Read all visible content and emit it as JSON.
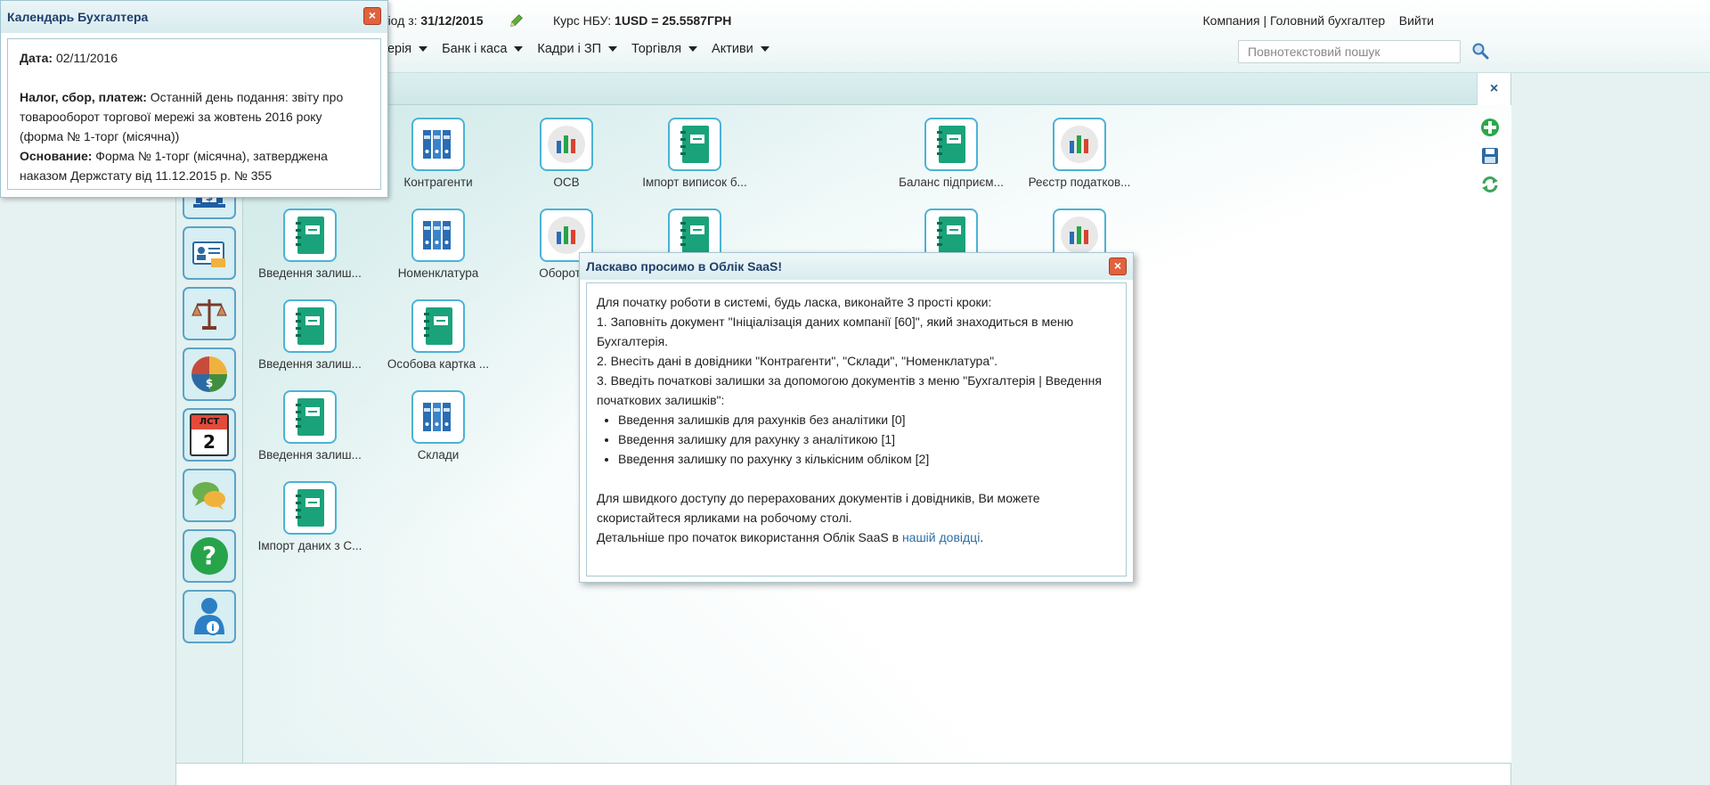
{
  "header": {
    "period_prefix": "еріод з:",
    "period_value": "31/12/2015",
    "rate_prefix": "Курс НБУ:",
    "rate_value": "1USD = 25.5587ГРН",
    "user_links": "Компания | Головний бухгалтер",
    "logout": "Вийти",
    "search_placeholder": "Повнотекстовий пошук"
  },
  "menu": [
    "лтерія",
    "Банк і каса",
    "Кадри і ЗП",
    "Торгівля",
    "Активи"
  ],
  "workspace": {
    "close_label": "×"
  },
  "rail": [
    "bank-icon",
    "card-icon",
    "scales-icon",
    "assets-icon",
    "calendar-icon",
    "chat-icon",
    "help-icon",
    "user-info-icon"
  ],
  "rail_calendar": {
    "month": "ЛСТ",
    "day": "2"
  },
  "tiles": [
    {
      "label": "Контрагенти",
      "icon": "binders-icon"
    },
    {
      "label": "ОСВ",
      "icon": "chart-icon"
    },
    {
      "label": "Імпорт виписок б...",
      "icon": "notebook-icon"
    },
    {
      "label": "Баланс підприєм...",
      "icon": "notebook-icon"
    },
    {
      "label": "Реєстр податков...",
      "icon": "chart-icon"
    },
    {
      "label": "Введення залиш...",
      "icon": "notebook-icon"
    },
    {
      "label": "Номенклатура",
      "icon": "binders-icon"
    },
    {
      "label": "Оборотна",
      "icon": "chart-icon"
    },
    {
      "label": "",
      "icon": "notebook-icon"
    },
    {
      "label": "",
      "icon": "notebook-icon"
    },
    {
      "label": "",
      "icon": "chart-icon"
    },
    {
      "label": "Введення залиш...",
      "icon": "notebook-icon"
    },
    {
      "label": "Особова картка ...",
      "icon": "notebook-icon"
    },
    {
      "label": "Введення залиш...",
      "icon": "notebook-icon"
    },
    {
      "label": "Склади",
      "icon": "binders-icon"
    },
    {
      "label": "Імпорт даних з С...",
      "icon": "notebook-icon"
    }
  ],
  "calendar_popup": {
    "title": "Календарь Бухгалтера",
    "date_label": "Дата:",
    "date_value": "02/11/2016",
    "tax_label": "Налог, сбор, платеж:",
    "tax_text": "Останній день подання: звіту про товарооборот торгової мережі за жовтень 2016 року (форма № 1-торг (місячна))",
    "basis_label": "Основание:",
    "basis_text": "Форма № 1-торг (місячна), затверджена наказом Держстату від 11.12.2015 р. № 355",
    "close_label": "×"
  },
  "welcome": {
    "title": "Ласкаво просимо в Облік SaaS!",
    "close_label": "×",
    "intro": "Для початку роботи в системі, будь ласка, виконайте 3 прості кроки:",
    "step1": "1. Заповніть документ \"Ініціалізація даних компанії [60]\", який знаходиться в меню Бухгалтерія.",
    "step2": "2. Внесіть дані в довідники \"Контрагенти\", \"Склади\", \"Номенклатура\".",
    "step3": "3. Введіть початкові залишки за допомогою документів з меню \"Бухгалтерія | Введення початкових залишків\":",
    "bullets": [
      "Введення залишків для рахунків без аналітики [0]",
      "Введення залишку для рахунку з аналітикою [1]",
      "Введення залишку по рахунку з кількісним обліком [2]"
    ],
    "quick_access": "Для швидкого доступу до перерахованих документів і довідників, Ви можете скористайтеся ярликами на робочому столі.",
    "more_prefix": "Детальніше про початок використання Облік SaaS в ",
    "more_link": "нашій довідці",
    "more_suffix": "."
  },
  "colors": {
    "accent": "#4ab3d6",
    "green": "#1aa37a",
    "close_red": "#e0623e",
    "title_blue": "#1f3f6b"
  }
}
